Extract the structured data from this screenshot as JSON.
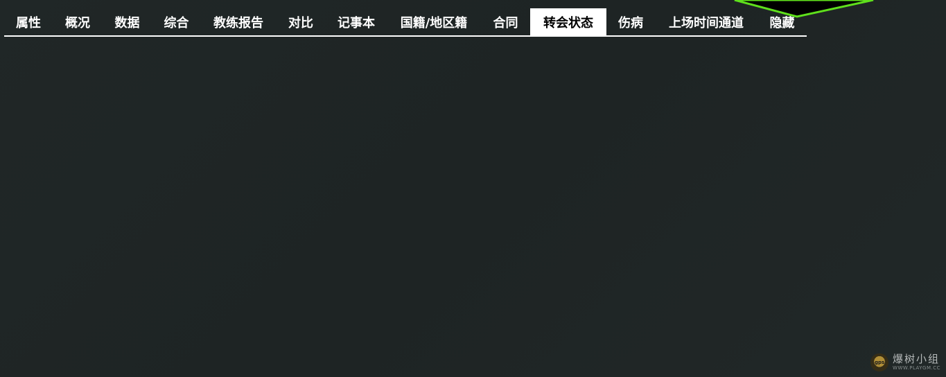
{
  "tabs": [
    {
      "label": "属性",
      "active": false
    },
    {
      "label": "概况",
      "active": false
    },
    {
      "label": "数据",
      "active": false
    },
    {
      "label": "综合",
      "active": false
    },
    {
      "label": "教练报告",
      "active": false
    },
    {
      "label": "对比",
      "active": false
    },
    {
      "label": "记事本",
      "active": false
    },
    {
      "label": "国籍/地区籍",
      "active": false
    },
    {
      "label": "合同",
      "active": false
    },
    {
      "label": "转会状态",
      "active": true
    },
    {
      "label": "伤病",
      "active": false
    },
    {
      "label": "上场时间通道",
      "active": false
    },
    {
      "label": "隐藏",
      "active": false
    }
  ],
  "watermark": {
    "badge": "gps",
    "text": "爆树小组",
    "url": "WWW.PLAYGM.CC"
  },
  "colors": {
    "background": "#1f2525",
    "tab_text": "#ffffff",
    "active_tab_bg": "#ffffff",
    "active_tab_text": "#000000",
    "accent_green": "#5fe01c"
  }
}
